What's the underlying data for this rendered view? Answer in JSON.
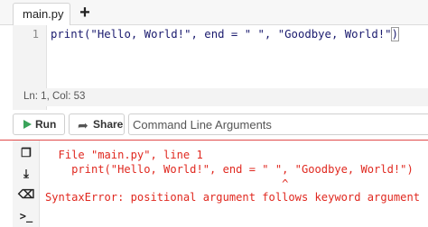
{
  "tabs": {
    "active_label": "main.py",
    "add_label": "+"
  },
  "editor": {
    "line_number": "1",
    "code_print": "print",
    "code_args": "(\"Hello, World!\", end = \" \", \"Goodbye, World!\"",
    "code_close": ")"
  },
  "status": {
    "position": "Ln: 1,  Col: 53"
  },
  "toolbar": {
    "run_label": "Run",
    "share_label": "Share",
    "args_placeholder": "Command Line Arguments"
  },
  "console": {
    "tools": {
      "copy": "❐",
      "download": "⤓",
      "erase": "⌫",
      "terminal": ">_"
    },
    "lines": [
      "  File \"main.py\", line 1",
      "    print(\"Hello, World!\", end = \" \", \"Goodbye, World!\")",
      "                                    ^",
      "SyntaxError: positional argument follows keyword argument"
    ]
  },
  "colors": {
    "error_red": "#e0281f",
    "run_green": "#3aa35a",
    "divider_red": "#e04a4a"
  }
}
